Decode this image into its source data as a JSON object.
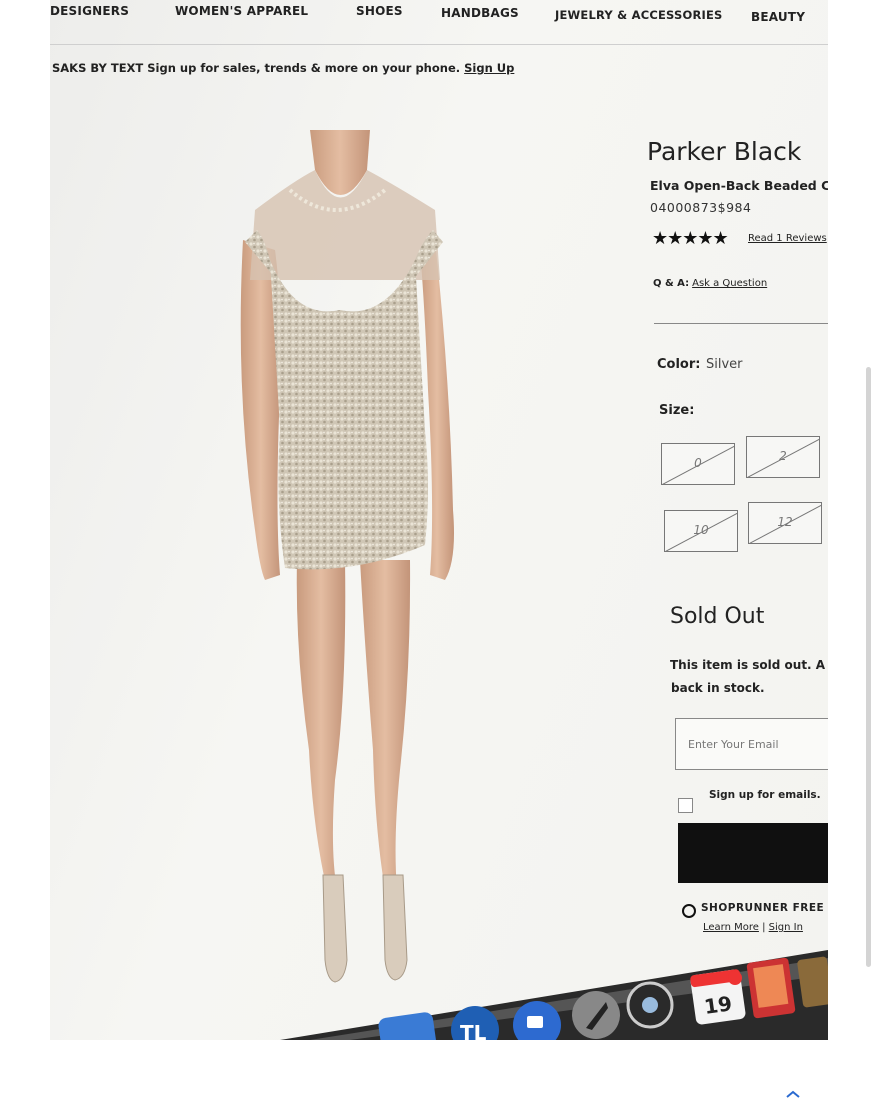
{
  "nav": {
    "items": [
      "DESIGNERS",
      "WOMEN'S APPAREL",
      "SHOES",
      "HANDBAGS",
      "JEWELRY & ACCESSORIES",
      "BEAUTY"
    ]
  },
  "promo": {
    "label": "SAKS BY TEXT Sign up for sales, trends & more on your phone.",
    "link": "Sign Up"
  },
  "product": {
    "brand": "Parker Black",
    "name": "Elva Open-Back Beaded C",
    "sku": "04000873$984",
    "stars": "★★★★★",
    "reviews_link": "Read 1 Reviews",
    "qa_label": "Q & A:",
    "qa_link": "Ask a Question",
    "color_label": "Color:",
    "color_value": "Silver",
    "size_label": "Size:",
    "sizes": [
      "0",
      "2",
      "10",
      "12"
    ],
    "status": "Sold Out",
    "sold_message_line1": "This item is sold out. A",
    "sold_message_line2": "back in stock."
  },
  "notify": {
    "email_placeholder": "Enter Your Email",
    "signup_label": "Sign up for emails."
  },
  "shoprunner": {
    "label": "SHOPRUNNER FREE",
    "learn_more": "Learn More",
    "separator": " | ",
    "sign_in": "Sign In"
  },
  "dock": {
    "calendar_day": "19"
  },
  "colors": {
    "screen_bg": "#f3f3f0",
    "button": "#101010",
    "text": "#222222"
  }
}
